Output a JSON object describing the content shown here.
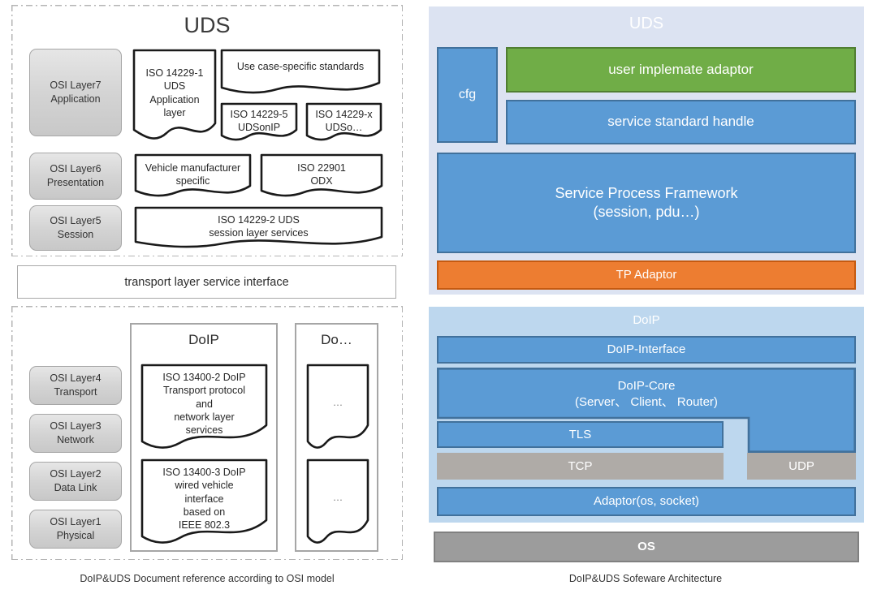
{
  "left": {
    "uds_title": "UDS",
    "osi_layers_top": [
      {
        "line1": "OSI Layer7",
        "line2": "Application"
      },
      {
        "line1": "OSI Layer6",
        "line2": "Presentation"
      },
      {
        "line1": "OSI Layer5",
        "line2": "Session"
      }
    ],
    "osi_layers_bottom": [
      {
        "line1": "OSI Layer4",
        "line2": "Transport"
      },
      {
        "line1": "OSI Layer3",
        "line2": "Network"
      },
      {
        "line1": "OSI Layer2",
        "line2": "Data Link"
      },
      {
        "line1": "OSI Layer1",
        "line2": "Physical"
      }
    ],
    "docs": {
      "iso14229_1": "ISO 14229-1\nUDS\nApplication\nlayer",
      "use_case": "Use case-specific standards",
      "iso14229_5": "ISO 14229-5\nUDSonIP",
      "iso14229_x": "ISO 14229-x\nUDSo…",
      "vehicle_mfr": "Vehicle manufacturer\nspecific",
      "iso22901": "ISO 22901\nODX",
      "iso14229_2": "ISO 14229-2 UDS\nsession layer services",
      "iso13400_2": "ISO 13400-2 DoIP\nTransport protocol\nand\nnetwork layer\nservices",
      "iso13400_3": "ISO 13400-3 DoIP\nwired vehicle\ninterface\nbased on\nIEEE 802.3",
      "ellipsis_1": "…",
      "ellipsis_2": "…"
    },
    "transport_interface": "transport layer service interface",
    "doip_group_title": "DoIP",
    "do_group_title": "Do…",
    "caption": "DoIP&UDS Document reference according to OSI model"
  },
  "right": {
    "uds": {
      "panel_label": "UDS",
      "cfg": "cfg",
      "user_adaptor": "user implemate adaptor",
      "service_handle": "service standard handle",
      "framework": "Service Process Framework\n(session, pdu…)",
      "tp_adaptor": "TP Adaptor"
    },
    "doip": {
      "panel_label": "DoIP",
      "interface": "DoIP-Interface",
      "core": "DoIP-Core\n(Server、 Client、 Router)",
      "tls": "TLS",
      "tcp": "TCP",
      "udp": "UDP",
      "adaptor": "Adaptor(os, socket)"
    },
    "os": "OS",
    "caption": "DoIP&UDS Sofeware Architecture"
  },
  "colors": {
    "blue": "#5B9BD5",
    "blue_border": "#41719C",
    "green": "#70AD47",
    "orange": "#ED7D31",
    "gray": "#AFABA7",
    "gray_dark": "#9C9C9C",
    "uds_panel_bg": "#DCE3F2",
    "doip_panel_bg": "#BDD7EE",
    "osi_box_gray": "#D4D4D4"
  }
}
